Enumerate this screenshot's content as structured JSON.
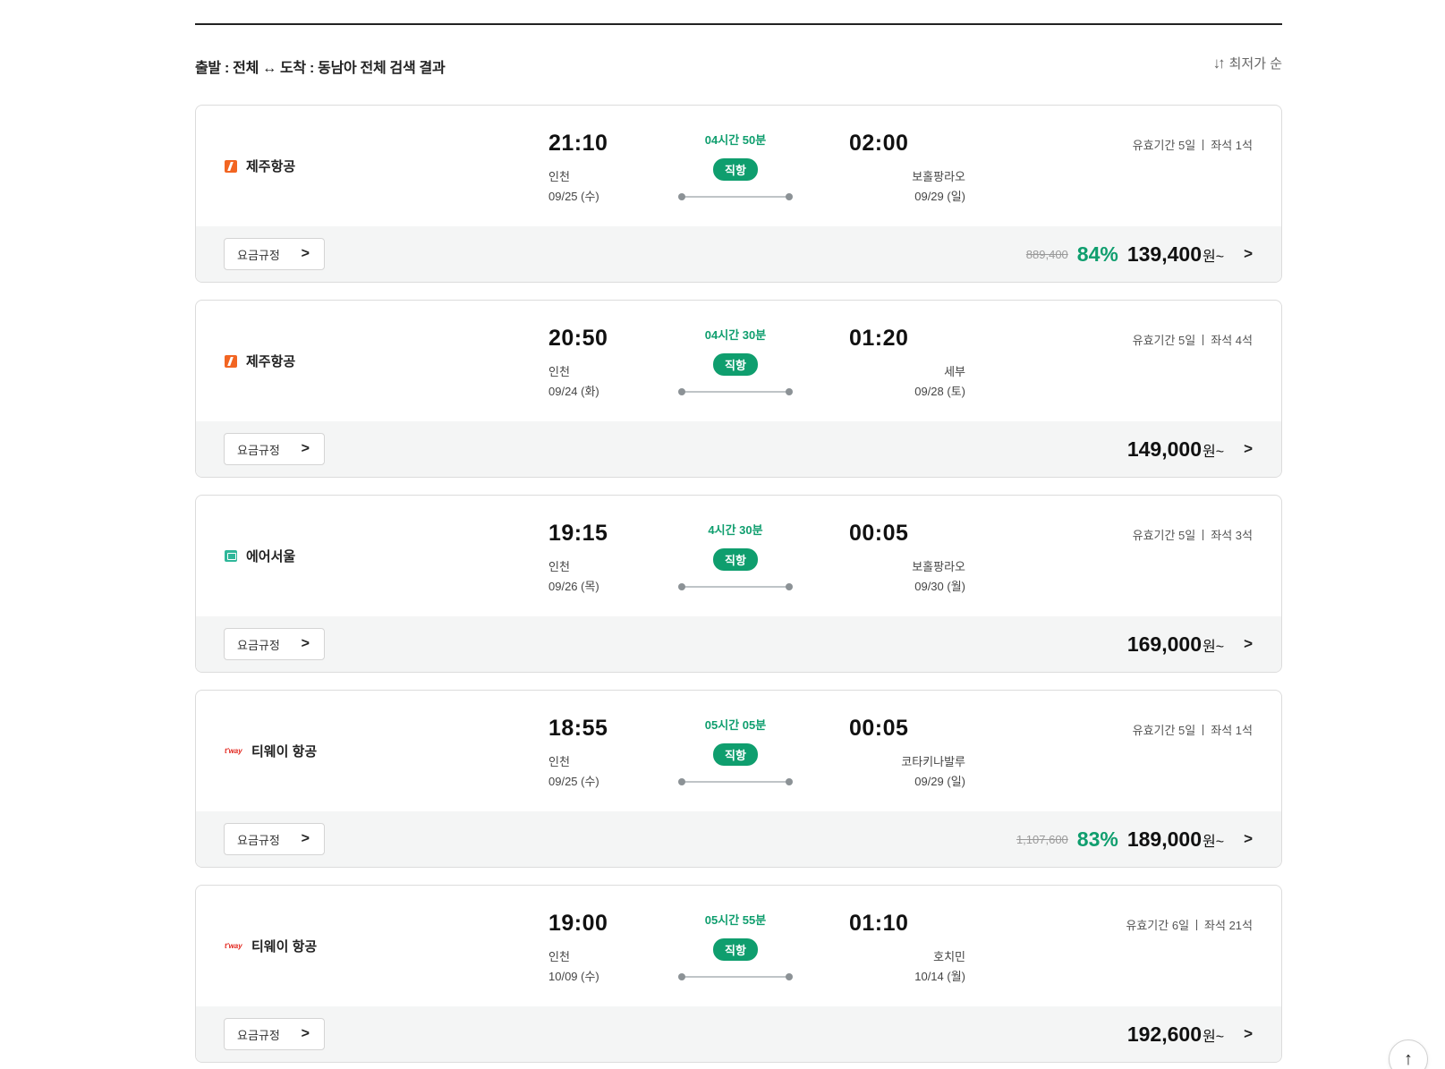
{
  "header": {
    "search_summary": "출발 : 전체 ↔ 도착 : 동남아 전체 검색 결과",
    "sort_label": "최저가 순",
    "sort_icon": "sort-arrows-icon"
  },
  "common": {
    "fare_rules_label": "요금규정",
    "direct_label": "직항",
    "currency_suffix": "원~",
    "validity_prefix": "유효기간",
    "seats_prefix": "좌석"
  },
  "colors": {
    "accent_green": "#0f9e6e",
    "jeju_orange": "#f26522",
    "airseoul_teal": "#2fb79a",
    "tway_red": "#e2231a"
  },
  "flights": [
    {
      "airline": "제주항공",
      "logo": "jeju",
      "dep_time": "21:10",
      "dep_city": "인천",
      "dep_date": "09/25 (수)",
      "duration": "04시간 50분",
      "arr_time": "02:00",
      "arr_city": "보홀팡라오",
      "arr_date": "09/29 (일)",
      "validity": "유효기간 5일",
      "seats": "좌석 1석",
      "orig_price": "889,400",
      "discount": "84%",
      "price": "139,400"
    },
    {
      "airline": "제주항공",
      "logo": "jeju",
      "dep_time": "20:50",
      "dep_city": "인천",
      "dep_date": "09/24 (화)",
      "duration": "04시간 30분",
      "arr_time": "01:20",
      "arr_city": "세부",
      "arr_date": "09/28 (토)",
      "validity": "유효기간 5일",
      "seats": "좌석 4석",
      "orig_price": "",
      "discount": "",
      "price": "149,000"
    },
    {
      "airline": "에어서울",
      "logo": "airseoul",
      "dep_time": "19:15",
      "dep_city": "인천",
      "dep_date": "09/26 (목)",
      "duration": "4시간 30분",
      "arr_time": "00:05",
      "arr_city": "보홀팡라오",
      "arr_date": "09/30 (월)",
      "validity": "유효기간 5일",
      "seats": "좌석 3석",
      "orig_price": "",
      "discount": "",
      "price": "169,000"
    },
    {
      "airline": "티웨이 항공",
      "logo": "tway",
      "dep_time": "18:55",
      "dep_city": "인천",
      "dep_date": "09/25 (수)",
      "duration": "05시간 05분",
      "arr_time": "00:05",
      "arr_city": "코타키나발루",
      "arr_date": "09/29 (일)",
      "validity": "유효기간 5일",
      "seats": "좌석 1석",
      "orig_price": "1,107,600",
      "discount": "83%",
      "price": "189,000"
    },
    {
      "airline": "티웨이 항공",
      "logo": "tway",
      "dep_time": "19:00",
      "dep_city": "인천",
      "dep_date": "10/09 (수)",
      "duration": "05시간 55분",
      "arr_time": "01:10",
      "arr_city": "호치민",
      "arr_date": "10/14 (월)",
      "validity": "유효기간 6일",
      "seats": "좌석 21석",
      "orig_price": "",
      "discount": "",
      "price": "192,600"
    }
  ],
  "tway_logo_text": "t'way",
  "scroll_top_icon": "arrow-up-icon"
}
